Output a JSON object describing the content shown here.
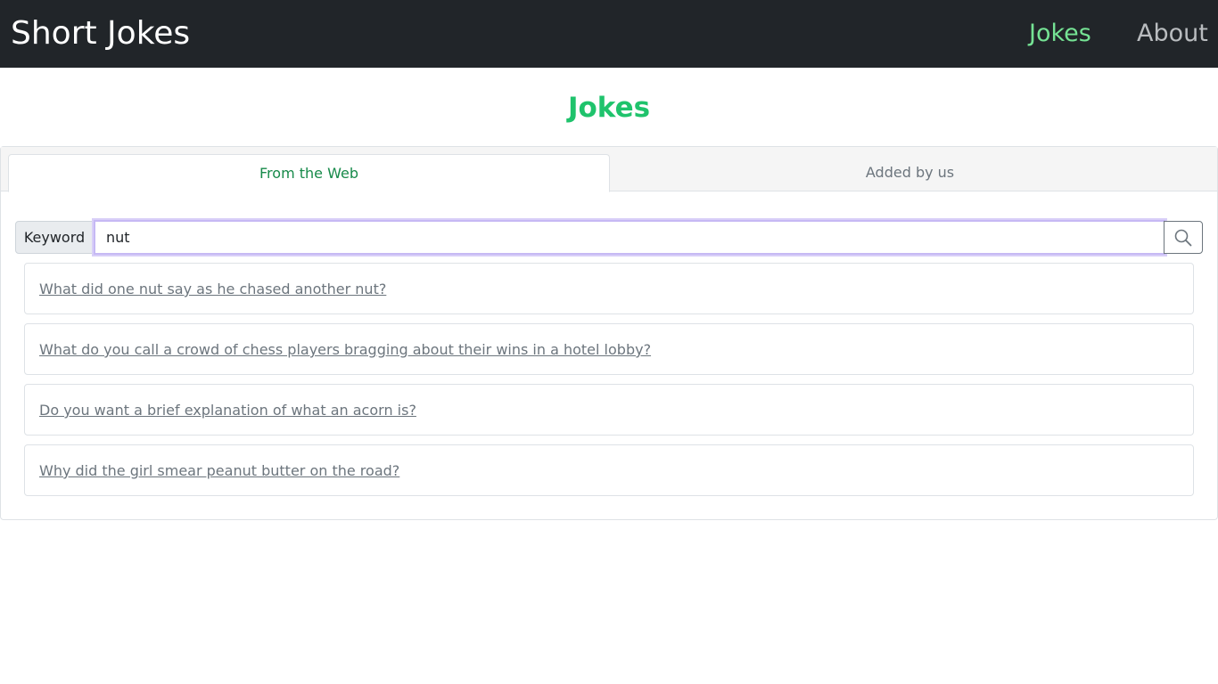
{
  "navbar": {
    "brand": "Short Jokes",
    "links": [
      {
        "label": "Jokes",
        "active": true
      },
      {
        "label": "About",
        "active": false
      }
    ]
  },
  "page": {
    "title": "Jokes"
  },
  "tabs": [
    {
      "label": "From the Web",
      "active": true
    },
    {
      "label": "Added by us",
      "active": false
    }
  ],
  "search": {
    "label": "Keyword",
    "value": "nut",
    "button_icon": "search-icon"
  },
  "jokes": [
    "What did one nut say as he chased another nut?",
    "What do you call a crowd of chess players bragging about their wins in a hotel lobby?",
    "Do you want a brief explanation of what an acorn is?",
    "Why did the girl smear peanut butter on the road?"
  ],
  "colors": {
    "navbar_bg": "#212529",
    "accent": "#1fc36c",
    "nav_active": "#75e394",
    "focus_ring": "#c6b9f4"
  }
}
